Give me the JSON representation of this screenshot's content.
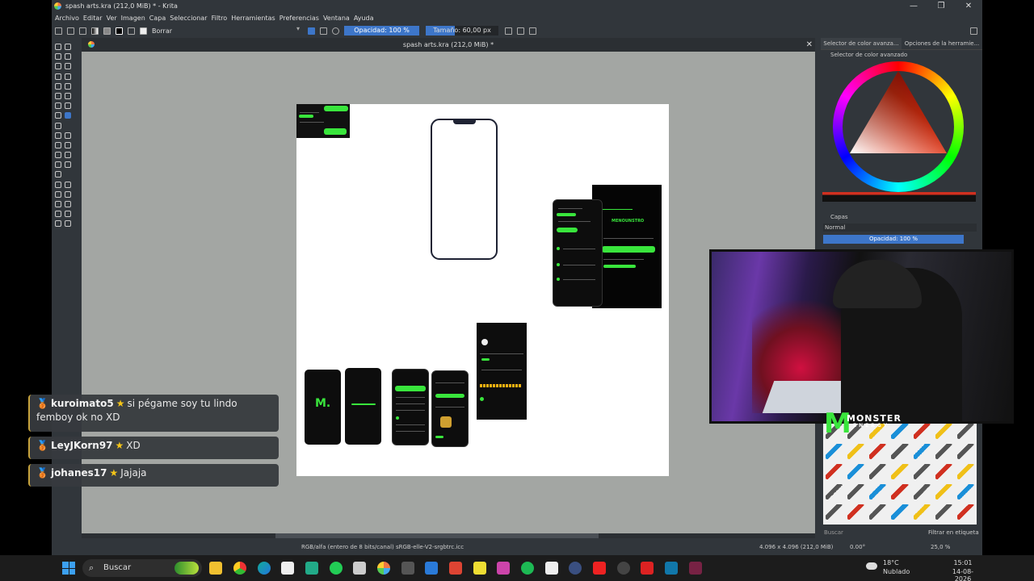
{
  "window": {
    "title": "spash arts.kra (212,0 MiB) * - Krita",
    "buttons": [
      "—",
      "❐",
      "✕"
    ]
  },
  "menu": [
    "Archivo",
    "Editar",
    "Ver",
    "Imagen",
    "Capa",
    "Seleccionar",
    "Filtro",
    "Herramientas",
    "Preferencias",
    "Ventana",
    "Ayuda"
  ],
  "toolbar": {
    "blend_mode": "Borrar",
    "opacity": "Opacidad: 100 %",
    "size": "Tamaño: 60,00 px"
  },
  "document": {
    "tab_title": "spash arts.kra (212,0 MiB) *",
    "close": "✕"
  },
  "mock_texts": {
    "brand": "MENOUNSTRO",
    "logo": "M."
  },
  "dockers": {
    "tabs": [
      "Selector de color avanza...",
      "Opciones de la herramie..."
    ],
    "color_selector_title": "Selector de color avanzado",
    "layers_title": "Capas",
    "blend": "Normal",
    "layer_opacity": "Opacidad:  100 %",
    "search_placeholder": "Buscar",
    "filter": "Filtrar en etiqueta"
  },
  "status": {
    "color_space": "RGB/alfa (entero de 8 bits/canal)  sRGB-elle-V2-srgbtrc.icc",
    "dimensions": "4.096 x 4.096 (212,0 MiB)",
    "rotation": "0.00°",
    "zoom": "25,0 %"
  },
  "chat": [
    {
      "user": "kuroimato5",
      "message": "si pégame soy tu lindo femboy ok no XD"
    },
    {
      "user": "LeyJKorn97",
      "message": "XD"
    },
    {
      "user": "johanes17",
      "message": "Jajaja"
    }
  ],
  "overlay": {
    "brand": "MONSTER",
    "sub": "ENERGY"
  },
  "taskbar": {
    "search": "Buscar",
    "weather_temp": "18°C",
    "weather_desc": "Nublado",
    "time": "15:01",
    "date": "14-08-2026",
    "apps": [
      "file-explorer",
      "chrome",
      "edge",
      "store",
      "maps",
      "green-app",
      "blender",
      "krita",
      "unity",
      "vscode",
      "office",
      "notes",
      "teams-purple",
      "spotify",
      "settings",
      "4k-video",
      "tiktok",
      "obs",
      "pdf",
      "photos",
      "w-app"
    ]
  },
  "colors": {
    "accent": "#3d76c9",
    "panel": "#31363b",
    "canvas_bg": "#a3a6a3",
    "monster_green": "#39e53c"
  }
}
